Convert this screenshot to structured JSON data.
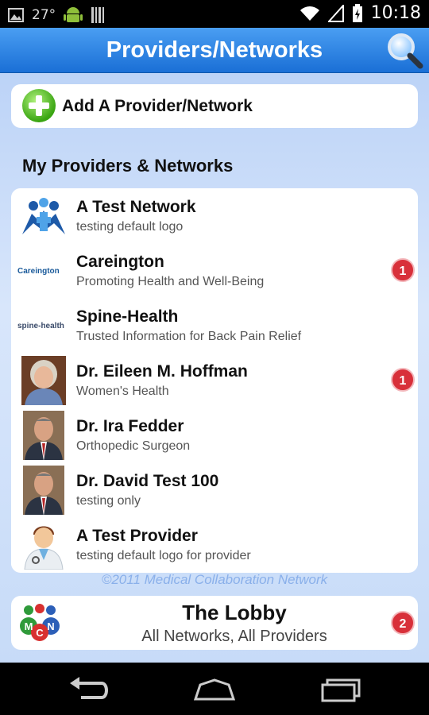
{
  "status_bar": {
    "temperature": "27°",
    "time": "10:18",
    "icons": [
      "image-icon",
      "android-icon",
      "barcode-icon",
      "wifi-icon",
      "signal-icon",
      "battery-icon"
    ]
  },
  "header": {
    "title": "Providers/Networks",
    "search_icon": "search-icon"
  },
  "add_button": {
    "label": "Add A Provider/Network",
    "icon": "add-circle-icon"
  },
  "section": {
    "title": "My Providers & Networks"
  },
  "providers": [
    {
      "name": "A Test Network",
      "subtitle": "testing default logo",
      "thumb": "network-logo",
      "badge": null
    },
    {
      "name": "Careington",
      "subtitle": "Promoting Health and Well-Being",
      "thumb": "careington-logo",
      "logo_text": "Careington",
      "badge": "1"
    },
    {
      "name": "Spine-Health",
      "subtitle": "Trusted Information for Back Pain Relief",
      "thumb": "spine-health-logo",
      "logo_text": "spine-health",
      "badge": null
    },
    {
      "name": "Dr. Eileen M. Hoffman",
      "subtitle": "Women's Health",
      "thumb": "photo",
      "badge": "1"
    },
    {
      "name": "Dr. Ira Fedder",
      "subtitle": "Orthopedic Surgeon",
      "thumb": "photo",
      "badge": null
    },
    {
      "name": "Dr. David Test 100",
      "subtitle": "testing only",
      "thumb": "photo",
      "badge": null
    },
    {
      "name": "A Test Provider",
      "subtitle": "testing default logo for provider",
      "thumb": "doctor-avatar",
      "badge": null
    }
  ],
  "copyright": "©2011 Medical Collaboration Network",
  "lobby": {
    "title": "The Lobby",
    "subtitle": "All Networks, All Providers",
    "badge": "2",
    "logo_letters": [
      "M",
      "C",
      "N"
    ]
  },
  "nav_bar": {
    "buttons": [
      "back-icon",
      "home-icon",
      "recent-apps-icon"
    ]
  },
  "colors": {
    "header_blue": "#1a6fd6",
    "badge_red": "#d8303a",
    "add_green": "#3aa512"
  }
}
